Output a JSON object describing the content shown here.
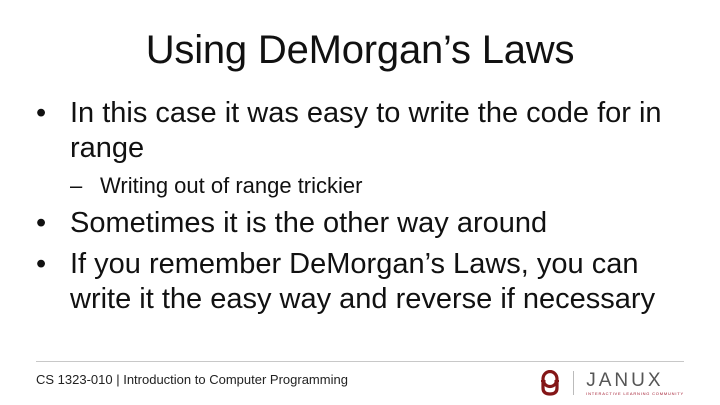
{
  "slide": {
    "title": "Using DeMorgan’s Laws",
    "bullets": [
      {
        "text": "In this case it was easy to write the code for in range",
        "sub": [
          "Writing out of range trickier"
        ]
      },
      {
        "text": "Sometimes it is the other way around",
        "sub": []
      },
      {
        "text": "If you remember DeMorgan’s Laws, you can write it the easy way and reverse if necessary",
        "sub": []
      }
    ],
    "bullet_glyph": "•",
    "sub_glyph": "–"
  },
  "footer": {
    "course": "CS 1323-010 | Introduction to Computer Programming",
    "logo_ou": "OU",
    "logo_word": "JANUX",
    "logo_tagline": "INTERACTIVE LEARNING COMMUNITY"
  },
  "colors": {
    "ou_crimson": "#841617",
    "janux_gray": "#555555",
    "divider": "#c8c8c8"
  },
  "icons": [
    "ou-logo-icon",
    "janux-logo"
  ]
}
